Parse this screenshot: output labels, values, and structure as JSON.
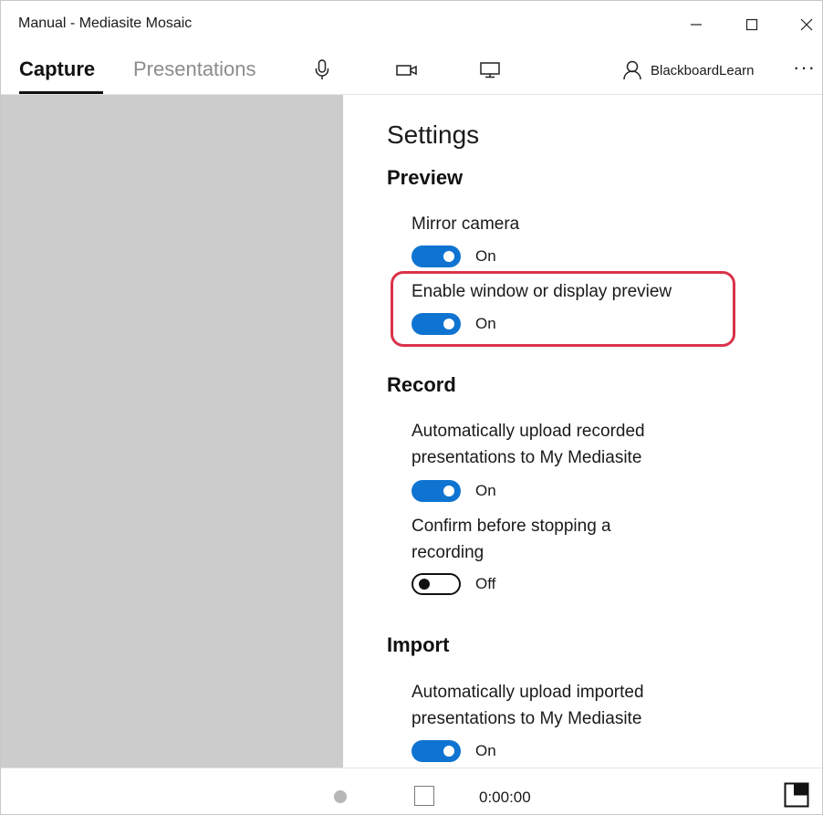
{
  "window": {
    "title": "Manual - Mediasite Mosaic",
    "minimize_icon": "minimize-icon",
    "maximize_icon": "maximize-icon",
    "close_icon": "close-icon"
  },
  "nav": {
    "tabs": [
      {
        "label": "Capture",
        "active": true
      },
      {
        "label": "Presentations",
        "active": false
      }
    ],
    "icons": [
      "microphone-icon",
      "camera-icon",
      "monitor-icon"
    ],
    "user": {
      "name": "BlackboardLearn",
      "icon": "user-icon"
    },
    "more_label": "···"
  },
  "settings": {
    "title": "Settings",
    "sections": [
      {
        "heading": "Preview",
        "items": [
          {
            "label": "Mirror camera",
            "state": "On"
          },
          {
            "label": "Enable window or display preview",
            "state": "On",
            "highlighted": true
          }
        ]
      },
      {
        "heading": "Record",
        "items": [
          {
            "label": "Automatically upload recorded presentations to My Mediasite",
            "state": "On"
          },
          {
            "label": "Confirm before stopping a recording",
            "state": "Off"
          }
        ]
      },
      {
        "heading": "Import",
        "items": [
          {
            "label": "Automatically upload imported presentations to My Mediasite",
            "state": "On"
          }
        ]
      }
    ]
  },
  "statusbar": {
    "timer": "0:00:00",
    "record_icon": "record-icon",
    "stop_icon": "stop-icon",
    "corner_icon": "picture-in-picture-icon"
  },
  "colors": {
    "accent": "#0f74d1",
    "highlight": "#d9324a",
    "preview_bg": "#cbcccb"
  }
}
